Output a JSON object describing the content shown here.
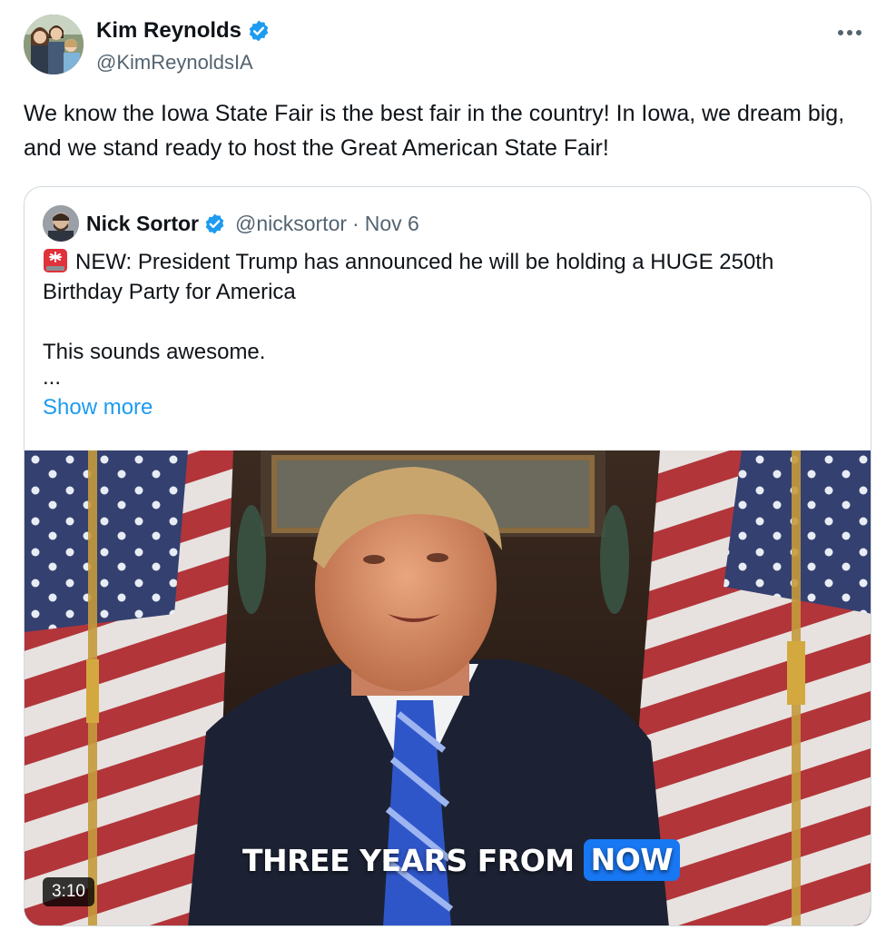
{
  "author": {
    "name": "Kim Reynolds",
    "handle": "@KimReynoldsIA",
    "avatar_icon": "family-photo-avatar",
    "verified_icon": "verified-badge-icon",
    "verified_color": "#1d9bf0"
  },
  "more_icon": "more-dots-icon",
  "tweet": {
    "text": "We know the Iowa State Fair is the best fair in the country! In Iowa, we dream big, and we stand ready to host the Great American State Fair!"
  },
  "quote": {
    "name": "Nick Sortor",
    "handle": "@nicksortor",
    "separator": "·",
    "date": "Nov 6",
    "lines": [
      "NEW: President Trump has announced he will be holding a HUGE 250th Birthday Party for America",
      "",
      "This sounds awesome.",
      "..."
    ],
    "siren_icon": "police-light-emoji",
    "show_more": "Show more",
    "video": {
      "caption_main": "THREE YEARS FROM",
      "caption_highlight": "NOW",
      "duration": "3:10",
      "highlight_color": "#1877f2"
    }
  }
}
